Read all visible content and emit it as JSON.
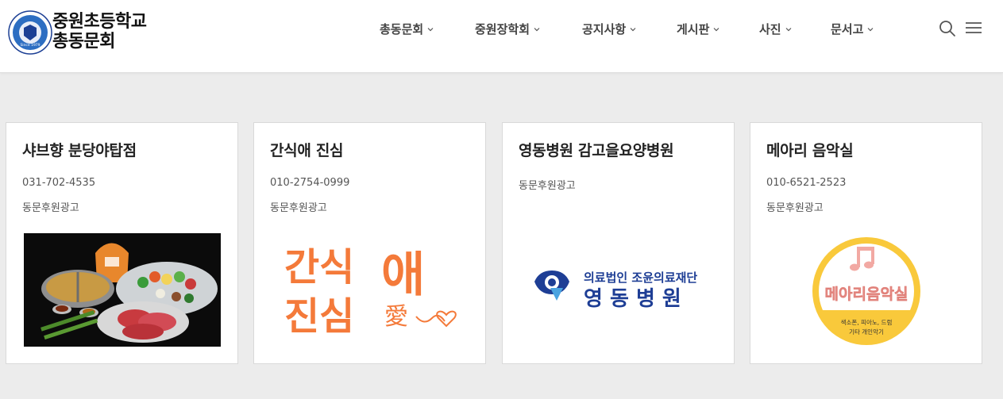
{
  "header": {
    "logo_icon": "school-emblem-icon",
    "logo_text": "Since 1979",
    "title_line1": "중원초등학교",
    "title_line2": "총동문회",
    "nav": [
      {
        "label": "총동문회"
      },
      {
        "label": "중원장학회"
      },
      {
        "label": "공지사항"
      },
      {
        "label": "게시판"
      },
      {
        "label": "사진"
      },
      {
        "label": "문서고"
      }
    ],
    "search_icon": "search-icon",
    "menu_icon": "hamburger-menu-icon"
  },
  "cards": [
    {
      "title": "샤브향 분당야탑점",
      "phone": "031-702-4535",
      "category": "동문후원광고",
      "image": "shabu-hotpot-photo"
    },
    {
      "title": "간식애 진심",
      "phone": "010-2754-0999",
      "category": "동문후원광고",
      "image_text_1": "간식",
      "image_text_2": "진심",
      "image_text_3": "애",
      "image_text_4": "愛"
    },
    {
      "title": "영동병원 감고을요양병원",
      "category": "동문후원광고",
      "logo_text_1": "의료법인 조윤의료재단",
      "logo_text_2": "영 동 병 원"
    },
    {
      "title": "메아리 음악실",
      "phone": "010-6521-2523",
      "category": "동문후원광고",
      "logo_text_1": "메아리음악실",
      "logo_text_2": "색소폰, 피아노, 드럼",
      "logo_text_3": "기타 개인악기"
    }
  ],
  "colors": {
    "background": "#ececec",
    "orange": "#f47a3a",
    "hospital_blue": "#1e3e95",
    "yellow": "#f9c93b",
    "pink": "#f2a9a3"
  }
}
